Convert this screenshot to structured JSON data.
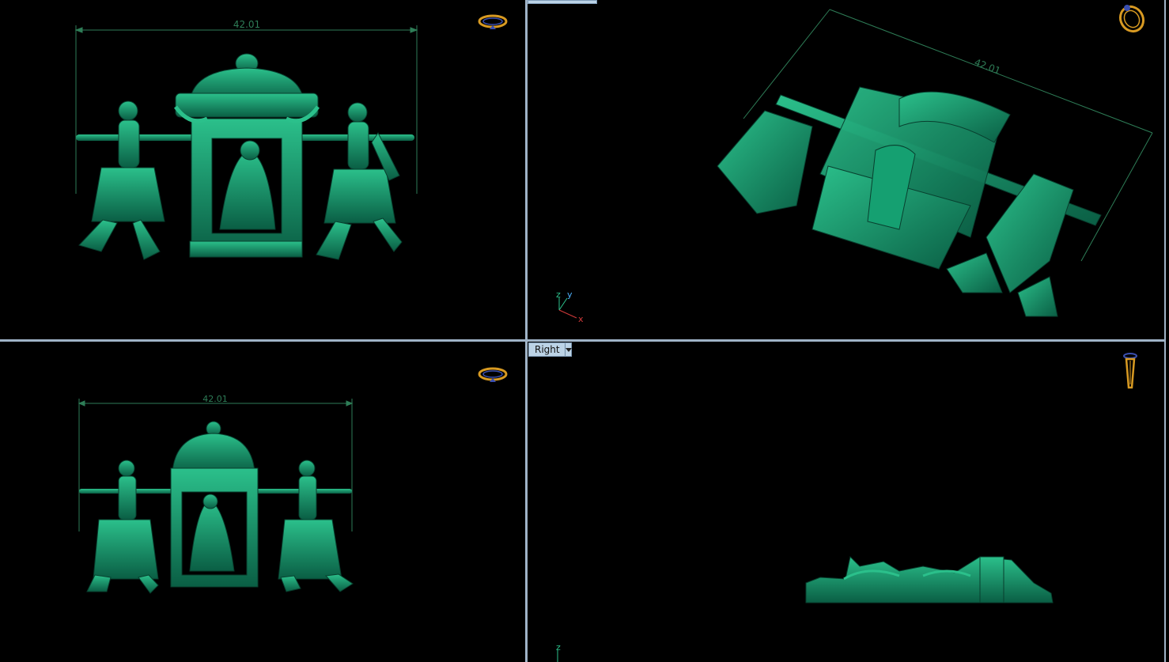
{
  "viewports": {
    "top_left": {
      "dimension": "42.01"
    },
    "top_right": {
      "dimension": "42.01",
      "axis": {
        "z": "z",
        "y": "y",
        "x": "x"
      }
    },
    "bottom_left": {
      "dimension": "42.01"
    },
    "bottom_right": {
      "label": "Right",
      "axis": {
        "z": "z"
      }
    }
  },
  "colors": {
    "model": "#0d7a58",
    "model_light": "#2bc08b",
    "dimension": "#2e7d57",
    "gizmo": "#d89a22",
    "separator": "#9fb3c7"
  },
  "icons": [
    "ring-gizmo-icon",
    "ring-3d-gizmo-icon",
    "ring-side-gizmo-icon",
    "dropdown-arrow-icon"
  ]
}
